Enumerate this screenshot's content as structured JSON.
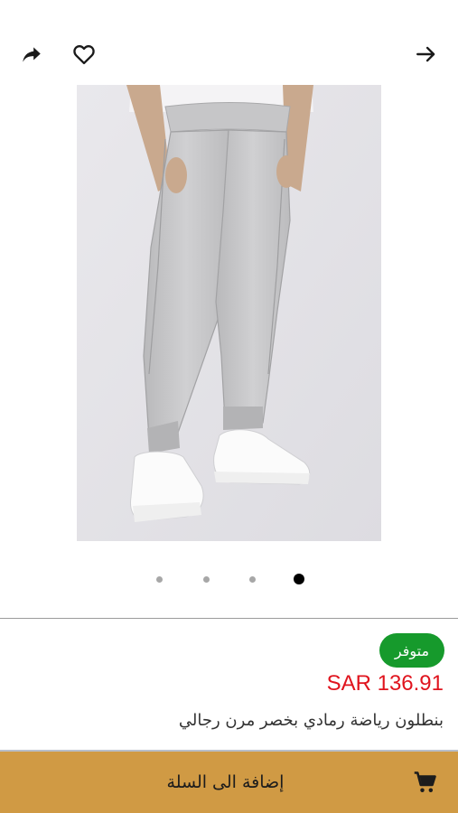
{
  "header": {
    "share_icon": "share-icon",
    "favorite_icon": "heart-outline-icon",
    "back_icon": "arrow-right-icon"
  },
  "product": {
    "image_alt": "grey jogger pants with white sneakers",
    "gallery": {
      "total_images": 4,
      "active_index": 4
    },
    "availability": "متوفر",
    "price": "SAR 136.91",
    "name": "بنطلون رياضة رمادي بخصر مرن رجالي"
  },
  "cart": {
    "label": "إضافة الى السلة",
    "icon": "cart-icon"
  },
  "colors": {
    "available_badge": "#169a2c",
    "price": "#e0141e",
    "cart_bar": "#d09a44"
  }
}
